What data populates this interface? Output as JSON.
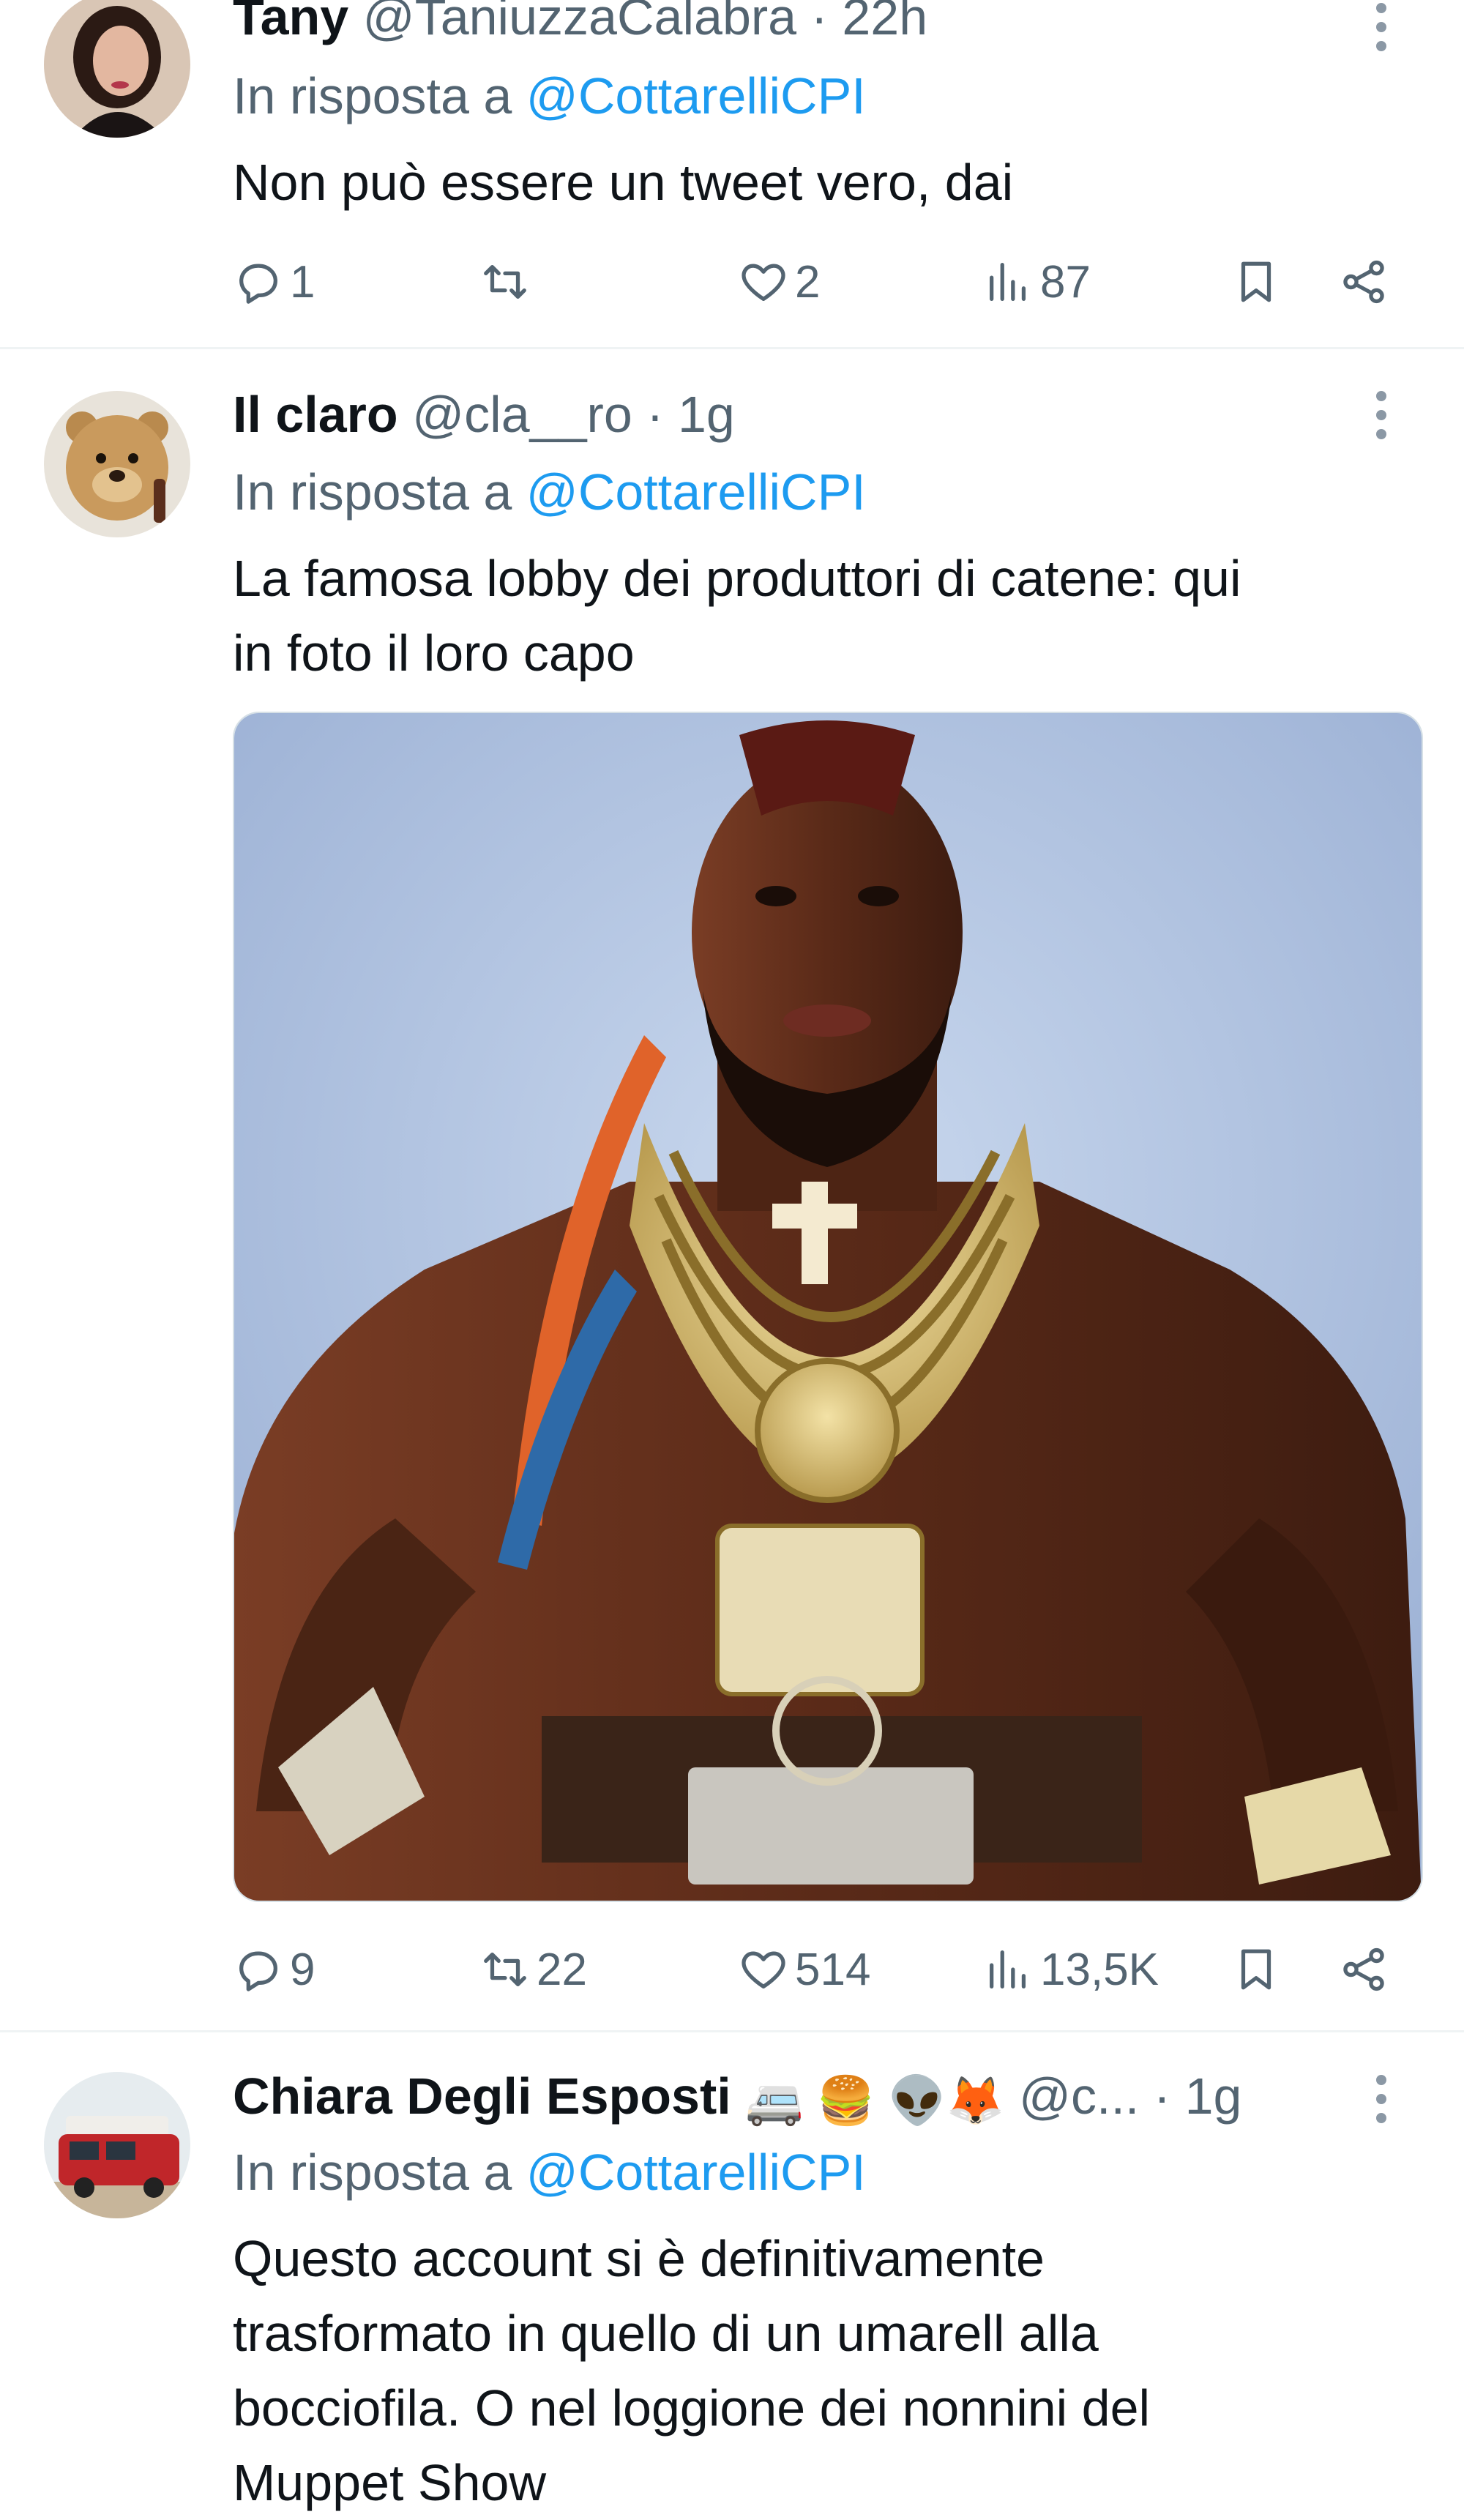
{
  "tweets": [
    {
      "name": "Tany",
      "handle": "@TaniuzzaCalabra",
      "time": "· 22h",
      "reply_prefix": "In risposta a",
      "reply_to": "@CottarelliCPI",
      "text": "Non può essere un tweet vero, dai",
      "counts": {
        "replies": "1",
        "retweets": "",
        "likes": "2",
        "views": "87"
      }
    },
    {
      "name": "Il claro",
      "handle": "@cla__ro",
      "time": "· 1g",
      "reply_prefix": "In risposta a",
      "reply_to": "@CottarelliCPI",
      "text_line1": "La famosa lobby dei produttori di catene: qui",
      "text_line2": "in foto il loro capo",
      "counts": {
        "replies": "9",
        "retweets": "22",
        "likes": "514",
        "views": "13,5K"
      }
    },
    {
      "name": "Chiara Degli Esposti",
      "name_emojis": "🚐 🍔 👽🦊",
      "handle": "@c...",
      "time": "· 1g",
      "reply_prefix": "In risposta a",
      "reply_to": "@CottarelliCPI",
      "text_lines": [
        "Questo account si è definitivamente",
        "trasformato in quello di un umarell alla",
        "bocciofila. O nel loggione dei nonnini del",
        "Muppet Show"
      ]
    }
  ],
  "icons": {
    "reply": "reply-icon",
    "retweet": "retweet-icon",
    "like": "heart-icon",
    "views": "views-icon",
    "bookmark": "bookmark-icon",
    "share": "share-icon",
    "more": "more-vertical-icon"
  },
  "colors": {
    "link": "#1d9bf0",
    "muted": "#536471",
    "text": "#0f1419"
  }
}
